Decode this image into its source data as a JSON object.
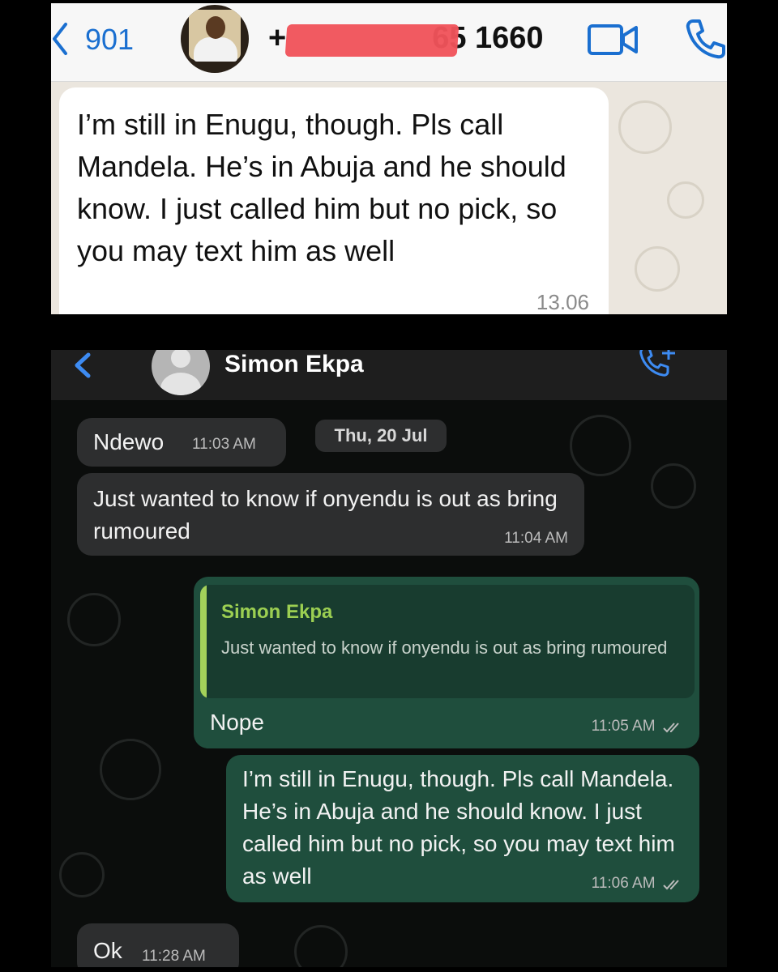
{
  "top_chat": {
    "back_count": "901",
    "phone_number": "+234 ••• 265 1660",
    "phone_visible_prefix": "+",
    "phone_visible_suffix": "65 1660",
    "message": {
      "text": "I’m still in Enugu, though. Pls call Mandela. He’s in Abuja and he should know. I just called him but no pick, so you may text him as well",
      "time": "13.06"
    },
    "icons": [
      "back-chevron-icon",
      "video-call-icon",
      "phone-call-icon"
    ],
    "accent_color": "#1a6fd0"
  },
  "bottom_chat": {
    "contact_name": "Simon Ekpa",
    "date_separator": "Thu, 20 Jul",
    "icons": [
      "back-chevron-icon",
      "add-call-icon",
      "double-check-icon"
    ],
    "messages": [
      {
        "direction": "in",
        "text": "Ndewo",
        "time": "11:03 AM"
      },
      {
        "direction": "in",
        "text": "Just wanted to know if onyendu is out as bring rumoured",
        "time": "11:04 AM"
      },
      {
        "direction": "out",
        "reply_to_name": "Simon Ekpa",
        "reply_to_text": "Just wanted to know if onyendu is out as bring rumoured",
        "text": "Nope",
        "time": "11:05 AM"
      },
      {
        "direction": "out",
        "text": "I’m still in Enugu, though. Pls call Mandela. He’s in Abuja and he should know. I just called him but no pick, so you may text him as well",
        "time": "11:06 AM"
      },
      {
        "direction": "in",
        "text": "Ok",
        "time": "11:28 AM"
      }
    ],
    "colors": {
      "incoming": "#2d2e2f",
      "outgoing": "#1f4e3d",
      "reply_accent": "#a3d15a"
    }
  }
}
